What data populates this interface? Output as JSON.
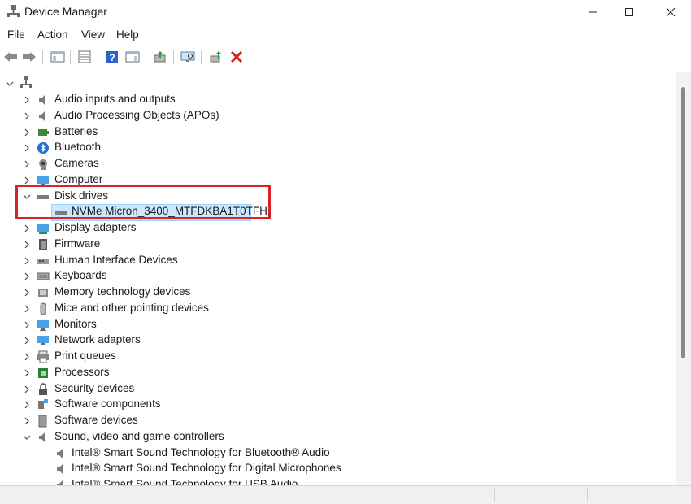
{
  "window": {
    "title": "Device Manager"
  },
  "menu": [
    "File",
    "Action",
    "Help",
    "View"
  ],
  "menu_items": {
    "file": "File",
    "action": "Action",
    "view": "View",
    "help": "Help"
  },
  "tree": {
    "categories": [
      {
        "label": "Audio inputs and outputs",
        "icon": "speaker-icon",
        "expanded": false
      },
      {
        "label": "Audio Processing Objects (APOs)",
        "icon": "speaker-icon",
        "expanded": false
      },
      {
        "label": "Batteries",
        "icon": "battery-icon",
        "expanded": false
      },
      {
        "label": "Bluetooth",
        "icon": "bluetooth-icon",
        "expanded": false
      },
      {
        "label": "Cameras",
        "icon": "camera-icon",
        "expanded": false
      },
      {
        "label": "Computer",
        "icon": "monitor-icon",
        "expanded": false
      },
      {
        "label": "Disk drives",
        "icon": "disk-drive-icon",
        "expanded": true
      },
      {
        "label": "Display adapters",
        "icon": "display-adapter-icon",
        "expanded": false
      },
      {
        "label": "Firmware",
        "icon": "firmware-icon",
        "expanded": false
      },
      {
        "label": "Human Interface Devices",
        "icon": "hid-icon",
        "expanded": false
      },
      {
        "label": "Keyboards",
        "icon": "keyboard-icon",
        "expanded": false
      },
      {
        "label": "Memory technology devices",
        "icon": "memory-icon",
        "expanded": false
      },
      {
        "label": "Mice and other pointing devices",
        "icon": "mouse-icon",
        "expanded": false
      },
      {
        "label": "Monitors",
        "icon": "monitor-icon",
        "expanded": false
      },
      {
        "label": "Network adapters",
        "icon": "network-icon",
        "expanded": false
      },
      {
        "label": "Print queues",
        "icon": "printer-icon",
        "expanded": false
      },
      {
        "label": "Processors",
        "icon": "processor-icon",
        "expanded": false
      },
      {
        "label": "Security devices",
        "icon": "security-icon",
        "expanded": false
      },
      {
        "label": "Software components",
        "icon": "software-component-icon",
        "expanded": false
      },
      {
        "label": "Software devices",
        "icon": "software-device-icon",
        "expanded": false
      },
      {
        "label": "Sound, video and game controllers",
        "icon": "speaker-icon",
        "expanded": true
      }
    ],
    "disk_child": "NVMe Micron_3400_MTFDKBA1T0TFH",
    "sound_children": [
      "Intel® Smart Sound Technology for Bluetooth® Audio",
      "Intel® Smart Sound Technology for Digital Microphones",
      "Intel® Smart Sound Technology for USB Audio"
    ]
  },
  "colors": {
    "selection": "#cce8ff",
    "highlight_box": "#d9232a"
  }
}
